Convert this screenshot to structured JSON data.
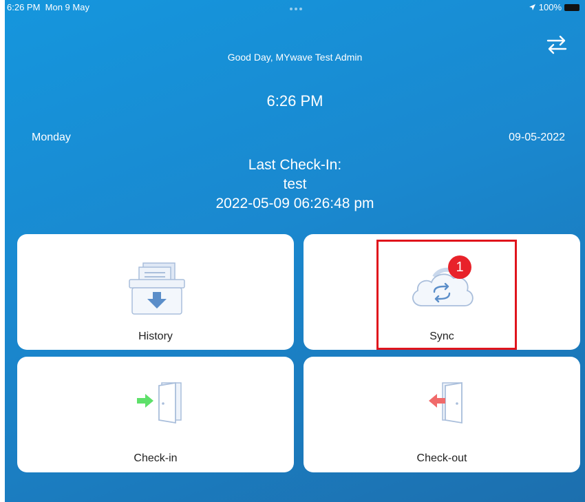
{
  "status_bar": {
    "time": "6:26 PM",
    "date": "Mon 9 May",
    "battery": "100%"
  },
  "greeting": "Good Day, MYwave Test Admin",
  "clock": "6:26 PM",
  "day": "Monday",
  "date": "09-05-2022",
  "last_checkin": {
    "heading": "Last Check-In:",
    "name": "test",
    "timestamp": "2022-05-09 06:26:48 pm"
  },
  "tiles": {
    "history": "History",
    "sync": "Sync",
    "checkin": "Check-in",
    "checkout": "Check-out"
  },
  "sync_badge": "1",
  "colors": {
    "background": "#1a88cf",
    "card": "#ffffff",
    "badge": "#e8222a",
    "highlight": "#e0141c",
    "arrow_in": "#5ee06a",
    "arrow_out": "#f06a6a"
  }
}
